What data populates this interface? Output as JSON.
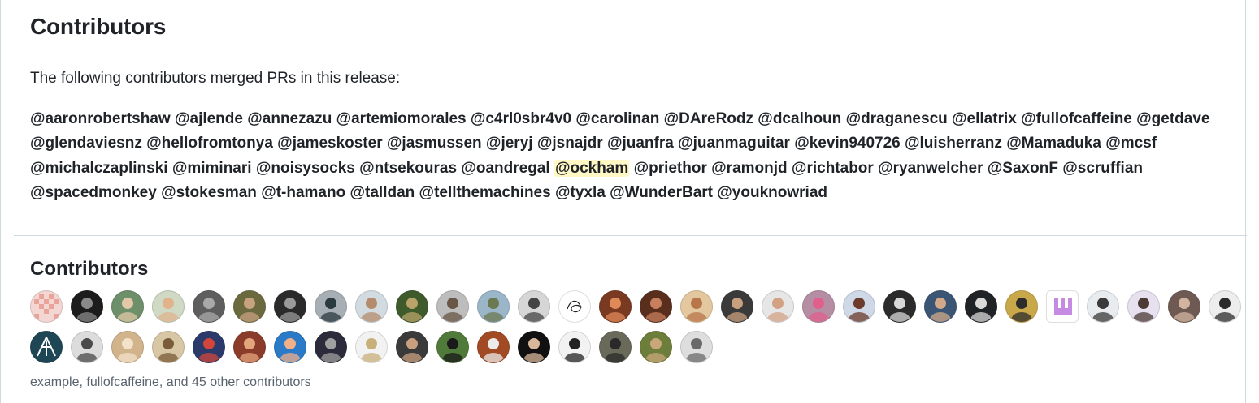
{
  "release_notes": {
    "heading": "Contributors",
    "intro": "The following contributors merged PRs in this release:",
    "mentions": [
      "@aaronrobertshaw",
      "@ajlende",
      "@annezazu",
      "@artemiomorales",
      "@c4rl0sbr4v0",
      "@carolinan",
      "@DAreRodz",
      "@dcalhoun",
      "@draganescu",
      "@ellatrix",
      "@fullofcaffeine",
      "@getdave",
      "@glendaviesnz",
      "@hellofromtonya",
      "@jameskoster",
      "@jasmussen",
      "@jeryj",
      "@jsnajdr",
      "@juanfra",
      "@juanmaguitar",
      "@kevin940726",
      "@luisherranz",
      "@Mamaduka",
      "@mcsf",
      "@michalczaplinski",
      "@miminari",
      "@noisysocks",
      "@ntsekouras",
      "@oandregal",
      "@ockham",
      "@priethor",
      "@ramonjd",
      "@richtabor",
      "@ryanwelcher",
      "@SaxonF",
      "@scruffian",
      "@spacedmonkey",
      "@stokesman",
      "@t-hamano",
      "@talldan",
      "@tellthemachines",
      "@tyxla",
      "@WunderBart",
      "@youknowriad"
    ],
    "highlighted_mention": "@ockham"
  },
  "contributors_panel": {
    "heading": "Contributors",
    "summary": "example, fullofcaffeine, and 45 other contributors",
    "avatars": [
      {
        "bg": "#f4d6d3",
        "fg": "#e8a39b",
        "kind": "identicon"
      },
      {
        "bg": "#1c1c1c",
        "fg": "#8a8a8a",
        "kind": "photo"
      },
      {
        "bg": "#6d8f6a",
        "fg": "#e3c8a8",
        "kind": "photo"
      },
      {
        "bg": "#cfd9c4",
        "fg": "#e0b38d",
        "kind": "photo"
      },
      {
        "bg": "#5e5e5e",
        "fg": "#a9a9a9",
        "kind": "photo"
      },
      {
        "bg": "#6b6a3f",
        "fg": "#c7a27f",
        "kind": "photo"
      },
      {
        "bg": "#2a2a2a",
        "fg": "#9a9a9a",
        "kind": "photo"
      },
      {
        "bg": "#a7aeb4",
        "fg": "#2b3a3f",
        "kind": "photo"
      },
      {
        "bg": "#d2dbe0",
        "fg": "#b48c6d",
        "kind": "photo"
      },
      {
        "bg": "#3f5b2c",
        "fg": "#b9a36a",
        "kind": "photo"
      },
      {
        "bg": "#bdbdbd",
        "fg": "#6a5646",
        "kind": "photo"
      },
      {
        "bg": "#9bb5c9",
        "fg": "#6b7a50",
        "kind": "photo"
      },
      {
        "bg": "#d6d6d6",
        "fg": "#444444",
        "kind": "photo"
      },
      {
        "bg": "#ffffff",
        "fg": "#222222",
        "kind": "sketch"
      },
      {
        "bg": "#7a3a22",
        "fg": "#e08a58",
        "kind": "photo"
      },
      {
        "bg": "#5a2e1c",
        "fg": "#c77f5d",
        "kind": "photo"
      },
      {
        "bg": "#e3c79f",
        "fg": "#b9764a",
        "kind": "photo"
      },
      {
        "bg": "#3a3a3a",
        "fg": "#c9a07e",
        "kind": "photo"
      },
      {
        "bg": "#e6e6e6",
        "fg": "#d3a285",
        "kind": "photo"
      },
      {
        "bg": "#b58ea3",
        "fg": "#e05f8d",
        "kind": "photo"
      },
      {
        "bg": "#cfd8e6",
        "fg": "#6b3b2b",
        "kind": "photo"
      },
      {
        "bg": "#2b2b2b",
        "fg": "#d8d8d8",
        "kind": "photo"
      },
      {
        "bg": "#3b5674",
        "fg": "#d1a98a",
        "kind": "photo"
      },
      {
        "bg": "#202326",
        "fg": "#d9d9d9",
        "kind": "photo"
      },
      {
        "bg": "#c9a84a",
        "fg": "#2c2c2c",
        "kind": "photo"
      },
      {
        "bg": "#ffffff",
        "fg": "#c58be3",
        "kind": "square-logo"
      },
      {
        "bg": "#e9ecef",
        "fg": "#3a3a3a",
        "kind": "photo"
      },
      {
        "bg": "#e7e0ef",
        "fg": "#4b3b34",
        "kind": "photo"
      },
      {
        "bg": "#6e5a53",
        "fg": "#d3b4a0",
        "kind": "photo"
      },
      {
        "bg": "#ededed",
        "fg": "#2b2b2b",
        "kind": "photo"
      },
      {
        "bg": "#1e4654",
        "fg": "#ffffff",
        "kind": "logo"
      },
      {
        "bg": "#dcdcdc",
        "fg": "#4a4a4a",
        "kind": "photo"
      },
      {
        "bg": "#d2b48c",
        "fg": "#f2e2c9",
        "kind": "photo"
      },
      {
        "bg": "#d8c7a5",
        "fg": "#7a5b3a",
        "kind": "photo"
      },
      {
        "bg": "#2b3a6b",
        "fg": "#d1453b",
        "kind": "photo"
      },
      {
        "bg": "#8a3b2a",
        "fg": "#e3a57c",
        "kind": "photo"
      },
      {
        "bg": "#2a7ac7",
        "fg": "#f0b089",
        "kind": "photo"
      },
      {
        "bg": "#2b2b3b",
        "fg": "#a0a0a0",
        "kind": "photo"
      },
      {
        "bg": "#f2f2f2",
        "fg": "#c7b07a",
        "kind": "photo"
      },
      {
        "bg": "#3a3a3a",
        "fg": "#c9a07e",
        "kind": "photo"
      },
      {
        "bg": "#4f7a3a",
        "fg": "#1a1a1a",
        "kind": "photo"
      },
      {
        "bg": "#a14a23",
        "fg": "#ececec",
        "kind": "photo"
      },
      {
        "bg": "#111111",
        "fg": "#d8b79b",
        "kind": "photo"
      },
      {
        "bg": "#f2f2f2",
        "fg": "#222222",
        "kind": "photo"
      },
      {
        "bg": "#6a6a5a",
        "fg": "#2a2a2a",
        "kind": "photo"
      },
      {
        "bg": "#6d7e3a",
        "fg": "#caa77b",
        "kind": "photo"
      },
      {
        "bg": "#dedede",
        "fg": "#6a6a6a",
        "kind": "photo"
      }
    ]
  }
}
